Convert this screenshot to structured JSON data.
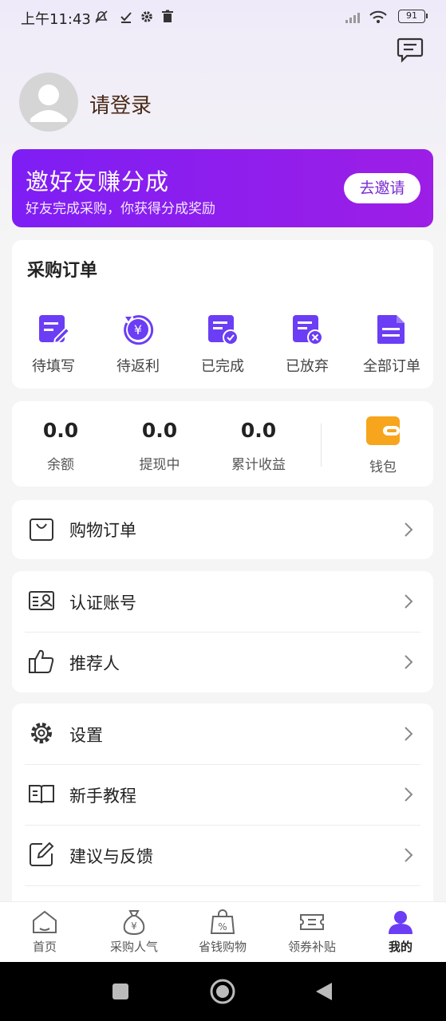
{
  "status_bar": {
    "time": "上午11:43",
    "battery": "91"
  },
  "profile": {
    "login_text": "请登录"
  },
  "invite_banner": {
    "title": "邀好友赚分成",
    "subtitle": "好友完成采购，你获得分成奖励",
    "button": "去邀请"
  },
  "purchase_orders": {
    "title": "采购订单",
    "items": [
      {
        "label": "待填写",
        "icon": "edit-doc-icon"
      },
      {
        "label": "待返利",
        "icon": "yuan-refresh-icon"
      },
      {
        "label": "已完成",
        "icon": "check-doc-icon"
      },
      {
        "label": "已放弃",
        "icon": "cancel-doc-icon"
      },
      {
        "label": "全部订单",
        "icon": "all-doc-icon"
      }
    ]
  },
  "wallet": {
    "stats": [
      {
        "value": "0.0",
        "label": "余额"
      },
      {
        "value": "0.0",
        "label": "提现中"
      },
      {
        "value": "0.0",
        "label": "累计收益"
      }
    ],
    "wallet_label": "钱包"
  },
  "menu": {
    "shopping_orders": "购物订单",
    "verify_account": "认证账号",
    "referrer": "推荐人",
    "settings": "设置",
    "tutorial": "新手教程",
    "feedback": "建议与反馈"
  },
  "tabbar": [
    {
      "label": "首页",
      "icon": "home-icon"
    },
    {
      "label": "采购人气",
      "icon": "money-bag-icon"
    },
    {
      "label": "省钱购物",
      "icon": "shopping-bag-icon"
    },
    {
      "label": "领券补贴",
      "icon": "coupon-icon"
    },
    {
      "label": "我的",
      "icon": "user-icon",
      "active": true
    }
  ],
  "colors": {
    "accent": "#7b22f0",
    "icon_purple": "#6b3df5",
    "wallet_orange": "#f7a51c"
  }
}
